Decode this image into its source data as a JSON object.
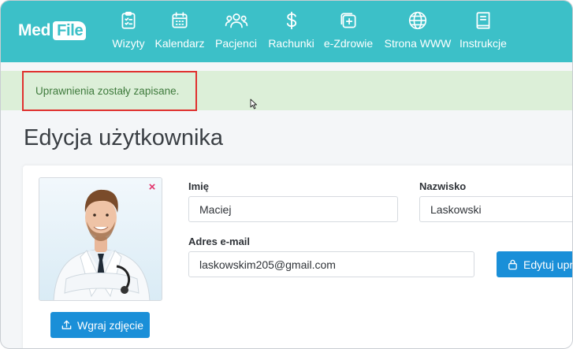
{
  "app": {
    "logo_part1": "Med",
    "logo_part2": "File",
    "colors": {
      "brand": "#3cc0c8",
      "primary": "#1a8fd8",
      "success_bg": "#dcefd8",
      "success_text": "#3e7a3c",
      "highlight": "#e0312f",
      "danger": "#e2336b"
    }
  },
  "nav": {
    "items": [
      {
        "label": "Wizyty",
        "icon": "clipboard-icon"
      },
      {
        "label": "Kalendarz",
        "icon": "calendar-icon"
      },
      {
        "label": "Pacjenci",
        "icon": "users-icon"
      },
      {
        "label": "Rachunki",
        "icon": "dollar-icon"
      },
      {
        "label": "e-Zdrowie",
        "icon": "medical-plus-icon"
      },
      {
        "label": "Strona WWW",
        "icon": "globe-icon"
      },
      {
        "label": "Instrukcje",
        "icon": "book-icon"
      }
    ]
  },
  "alert": {
    "message": "Uprawnienia zostały zapisane."
  },
  "page": {
    "title": "Edycja użytkownika"
  },
  "form": {
    "first_name": {
      "label": "Imię",
      "value": "Maciej"
    },
    "last_name": {
      "label": "Nazwisko",
      "value": "Laskowski"
    },
    "email": {
      "label": "Adres e-mail",
      "value": "laskowskim205@gmail.com"
    },
    "edit_permissions_button": "Edytuj upra",
    "upload_photo_button": "Wgraj zdjęcie",
    "remove_photo": "×"
  }
}
